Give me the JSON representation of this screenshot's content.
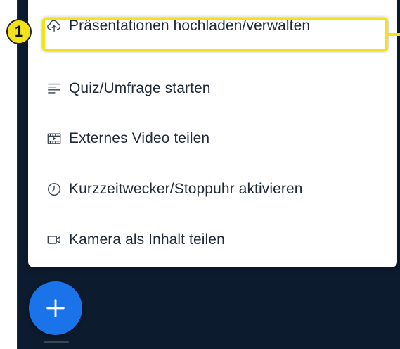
{
  "menu": {
    "items": [
      {
        "label": "Präsentationen hochladen/verwalten",
        "icon": "cloud-upload-icon"
      },
      {
        "label": "Quiz/Umfrage starten",
        "icon": "poll-list-icon"
      },
      {
        "label": "Externes Video teilen",
        "icon": "video-film-icon"
      },
      {
        "label": "Kurzzeitwecker/Stoppuhr aktivieren",
        "icon": "clock-icon"
      },
      {
        "label": "Kamera als Inhalt teilen",
        "icon": "video-camera-icon"
      }
    ]
  },
  "annotation": {
    "badge_number": "1",
    "highlight_color": "#f2e21a"
  },
  "fab": {
    "icon": "plus-icon",
    "color": "#1a73e8"
  },
  "colors": {
    "app_background": "#0d1b2e",
    "menu_background": "#ffffff",
    "text": "#1f2937"
  }
}
